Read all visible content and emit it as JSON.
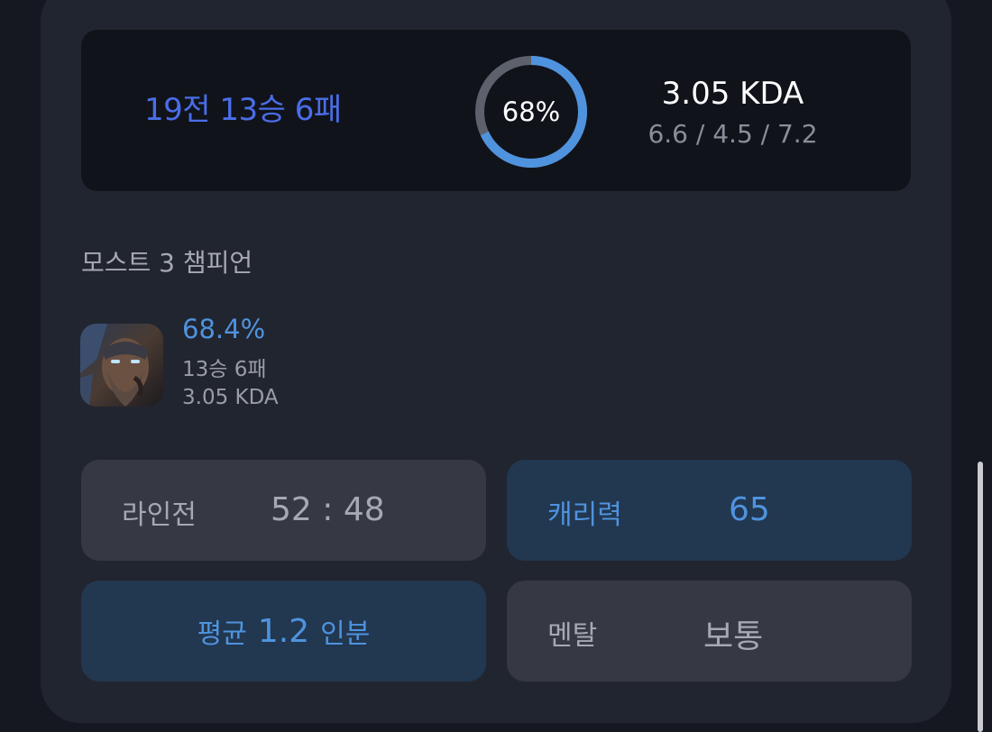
{
  "summary": {
    "record": "19전 13승 6패",
    "win_rate_label": "68%",
    "win_rate": 0.68,
    "kda": "3.05 KDA",
    "kda_detail": "6.6 / 4.5 / 7.2"
  },
  "most_champions": {
    "title": "모스트 3 챔피언",
    "items": [
      {
        "win_rate": "68.4%",
        "record": "13승 6패",
        "kda": "3.05 KDA"
      }
    ]
  },
  "stats": {
    "laning_label": "라인전",
    "laning_value": "52 : 48",
    "carry_label": "캐리력",
    "carry_value": "65",
    "average_label": "평균",
    "average_value": "1.2",
    "average_unit": "인분",
    "mental_label": "멘탈",
    "mental_value": "보통"
  },
  "colors": {
    "accent_blue": "#4f93de",
    "record_blue": "#4a6ee8",
    "ring_track": "#5d616b",
    "background": "#161821",
    "card": "#212530"
  }
}
